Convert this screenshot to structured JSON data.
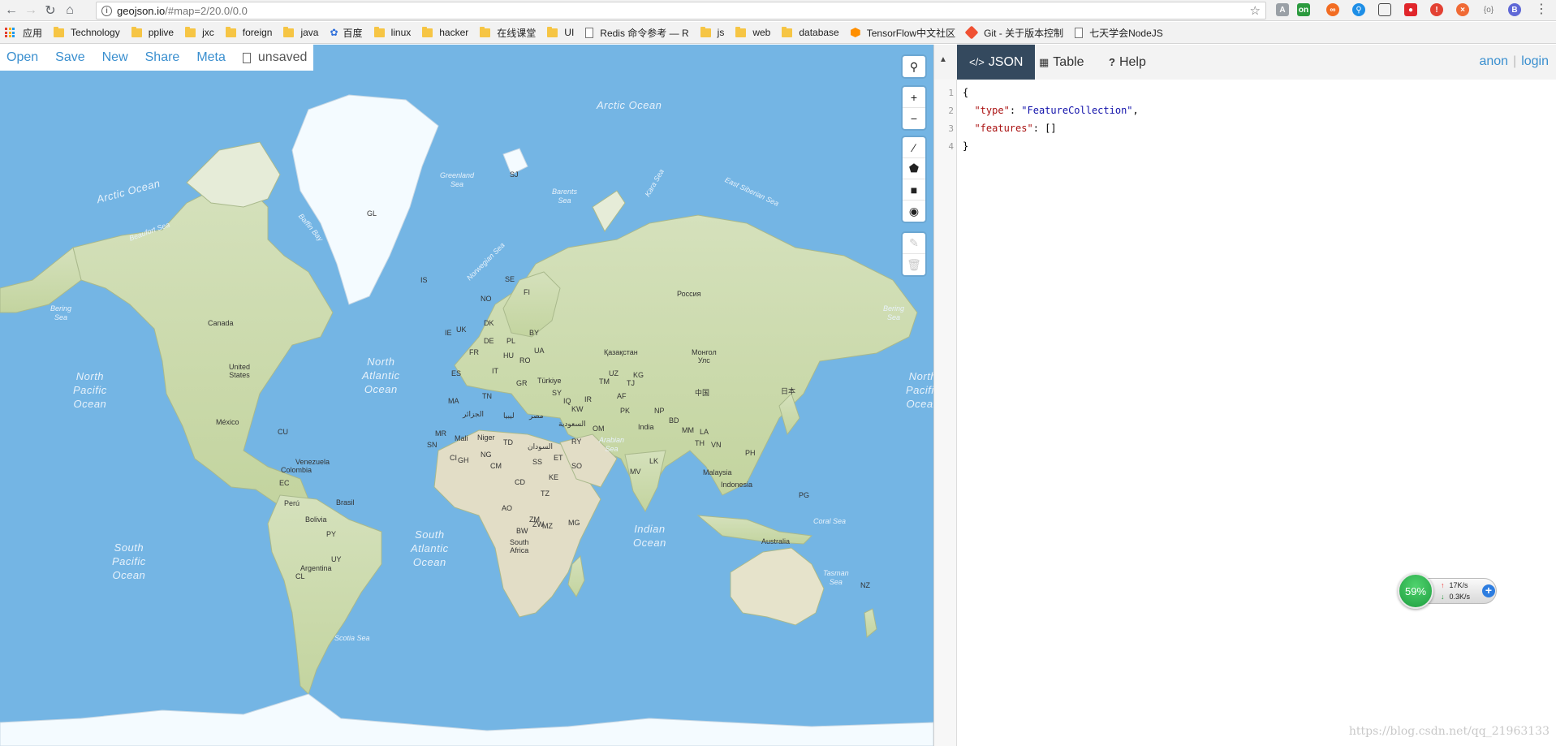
{
  "browser": {
    "url_host": "geojson.io",
    "url_path": "/#map=2/20.0/0.0",
    "bookmarks": [
      {
        "label": "应用",
        "type": "apps"
      },
      {
        "label": "Technology",
        "type": "folder"
      },
      {
        "label": "pplive",
        "type": "folder"
      },
      {
        "label": "jxc",
        "type": "folder"
      },
      {
        "label": "foreign",
        "type": "folder"
      },
      {
        "label": "java",
        "type": "folder"
      },
      {
        "label": "百度",
        "type": "paw"
      },
      {
        "label": "linux",
        "type": "folder"
      },
      {
        "label": "hacker",
        "type": "folder"
      },
      {
        "label": "在线课堂",
        "type": "folder"
      },
      {
        "label": "UI",
        "type": "folder"
      },
      {
        "label": "Redis 命令参考 — R",
        "type": "page"
      },
      {
        "label": "js",
        "type": "folder"
      },
      {
        "label": "web",
        "type": "folder"
      },
      {
        "label": "database",
        "type": "folder"
      },
      {
        "label": "TensorFlow中文社区",
        "type": "tf"
      },
      {
        "label": "Git - 关于版本控制",
        "type": "git"
      },
      {
        "label": "七天学会NodeJS",
        "type": "page"
      }
    ]
  },
  "map_menu": {
    "open": "Open",
    "save": "Save",
    "new": "New",
    "share": "Share",
    "meta": "Meta",
    "file_status": "unsaved"
  },
  "map": {
    "oceans": [
      {
        "id": "arctic-ocean-east",
        "text": "Arctic Ocean"
      },
      {
        "id": "arctic-ocean-west",
        "text": "Arctic Ocean"
      },
      {
        "id": "north-pacific-west",
        "text": "North\nPacific\nOcean"
      },
      {
        "id": "north-pacific-east",
        "text": "North\nPacific\nOcean"
      },
      {
        "id": "north-atlantic",
        "text": "North\nAtlantic\nOcean"
      },
      {
        "id": "south-atlantic",
        "text": "South\nAtlantic\nOcean"
      },
      {
        "id": "south-pacific",
        "text": "South\nPacific\nOcean"
      },
      {
        "id": "indian-ocean",
        "text": "Indian\nOcean"
      }
    ],
    "seas": [
      {
        "id": "greenland-sea",
        "text": "Greenland\nSea"
      },
      {
        "id": "barents-sea",
        "text": "Barents\nSea"
      },
      {
        "id": "kara-sea",
        "text": "Kara Sea"
      },
      {
        "id": "beaufort-sea",
        "text": "Beaufort Sea"
      },
      {
        "id": "baffin-bay",
        "text": "Baffin Bay"
      },
      {
        "id": "norwegian-sea",
        "text": "Norwegian Sea"
      },
      {
        "id": "bering-sea-west",
        "text": "Bering\nSea"
      },
      {
        "id": "bering-sea-east",
        "text": "Bering\nSea"
      },
      {
        "id": "arabian-sea",
        "text": "Arabian\nSea"
      },
      {
        "id": "coral-sea",
        "text": "Coral Sea"
      },
      {
        "id": "tasman-sea",
        "text": "Tasman\nSea"
      },
      {
        "id": "scotia-sea",
        "text": "Scotia Sea"
      },
      {
        "id": "east-siberian-sea",
        "text": "East Siberian Sea"
      }
    ],
    "places": [
      "GL",
      "SJ",
      "IS",
      "NO",
      "SE",
      "FI",
      "Россия",
      "Canada",
      "United\nStates",
      "México",
      "CU",
      "IE",
      "UK",
      "DK",
      "DE",
      "PL",
      "BY",
      "UA",
      "FR",
      "HU",
      "RO",
      "ES",
      "IT",
      "GR",
      "Türkiye",
      "Қазақстан",
      "Монгол\nУлс",
      "UZ",
      "KG",
      "TM",
      "TJ",
      "AF",
      "PK",
      "IR",
      "SY",
      "IQ",
      "KW",
      "MA",
      "TN",
      "الجزائر",
      "ليبيا",
      "مصر",
      "السعودية",
      "OM",
      "RY",
      "India",
      "NP",
      "BD",
      "MM",
      "LA",
      "TH",
      "VN",
      "PH",
      "中国",
      "日本",
      "MR",
      "Mali",
      "Niger",
      "TD",
      "السودان",
      "SN",
      "GH",
      "CI",
      "NG",
      "CM",
      "SS",
      "ET",
      "SO",
      "KE",
      "CD",
      "TZ",
      "AO",
      "ZM",
      "MZ",
      "MG",
      "BW",
      "South\nAfrica",
      "ZW",
      "MV",
      "LK",
      "Malaysia",
      "Indonesia",
      "PG",
      "Australia",
      "NZ",
      "Venezuela",
      "Colombia",
      "EC",
      "Perú",
      "Brasil",
      "Bolivia",
      "PY",
      "UY",
      "Argentina",
      "CL"
    ]
  },
  "panel": {
    "tabs": [
      {
        "label": "JSON",
        "icon": "code-icon"
      },
      {
        "label": "Table",
        "icon": "table-icon"
      },
      {
        "label": "Help",
        "icon": "question-icon"
      }
    ],
    "user": "anon",
    "login": "login",
    "line_numbers": [
      "1",
      "2",
      "3",
      "4"
    ],
    "code": {
      "l1": "{",
      "l2_key": "\"type\"",
      "l2_sep": ": ",
      "l2_val": "\"FeatureCollection\"",
      "l2_end": ",",
      "l3_key": "\"features\"",
      "l3_sep": ": ",
      "l3_val": "[]",
      "l4": "}"
    }
  },
  "speed_widget": {
    "percent": "59%",
    "up": "17K/s",
    "down": "0.3K/s"
  },
  "watermark": "https://blog.csdn.net/qq_21963133",
  "colors": {
    "water": "#74b5e4",
    "land": "#cfddb1",
    "ice": "#f4fbff",
    "link": "#3a8fcf",
    "active_tab": "#34495e"
  }
}
